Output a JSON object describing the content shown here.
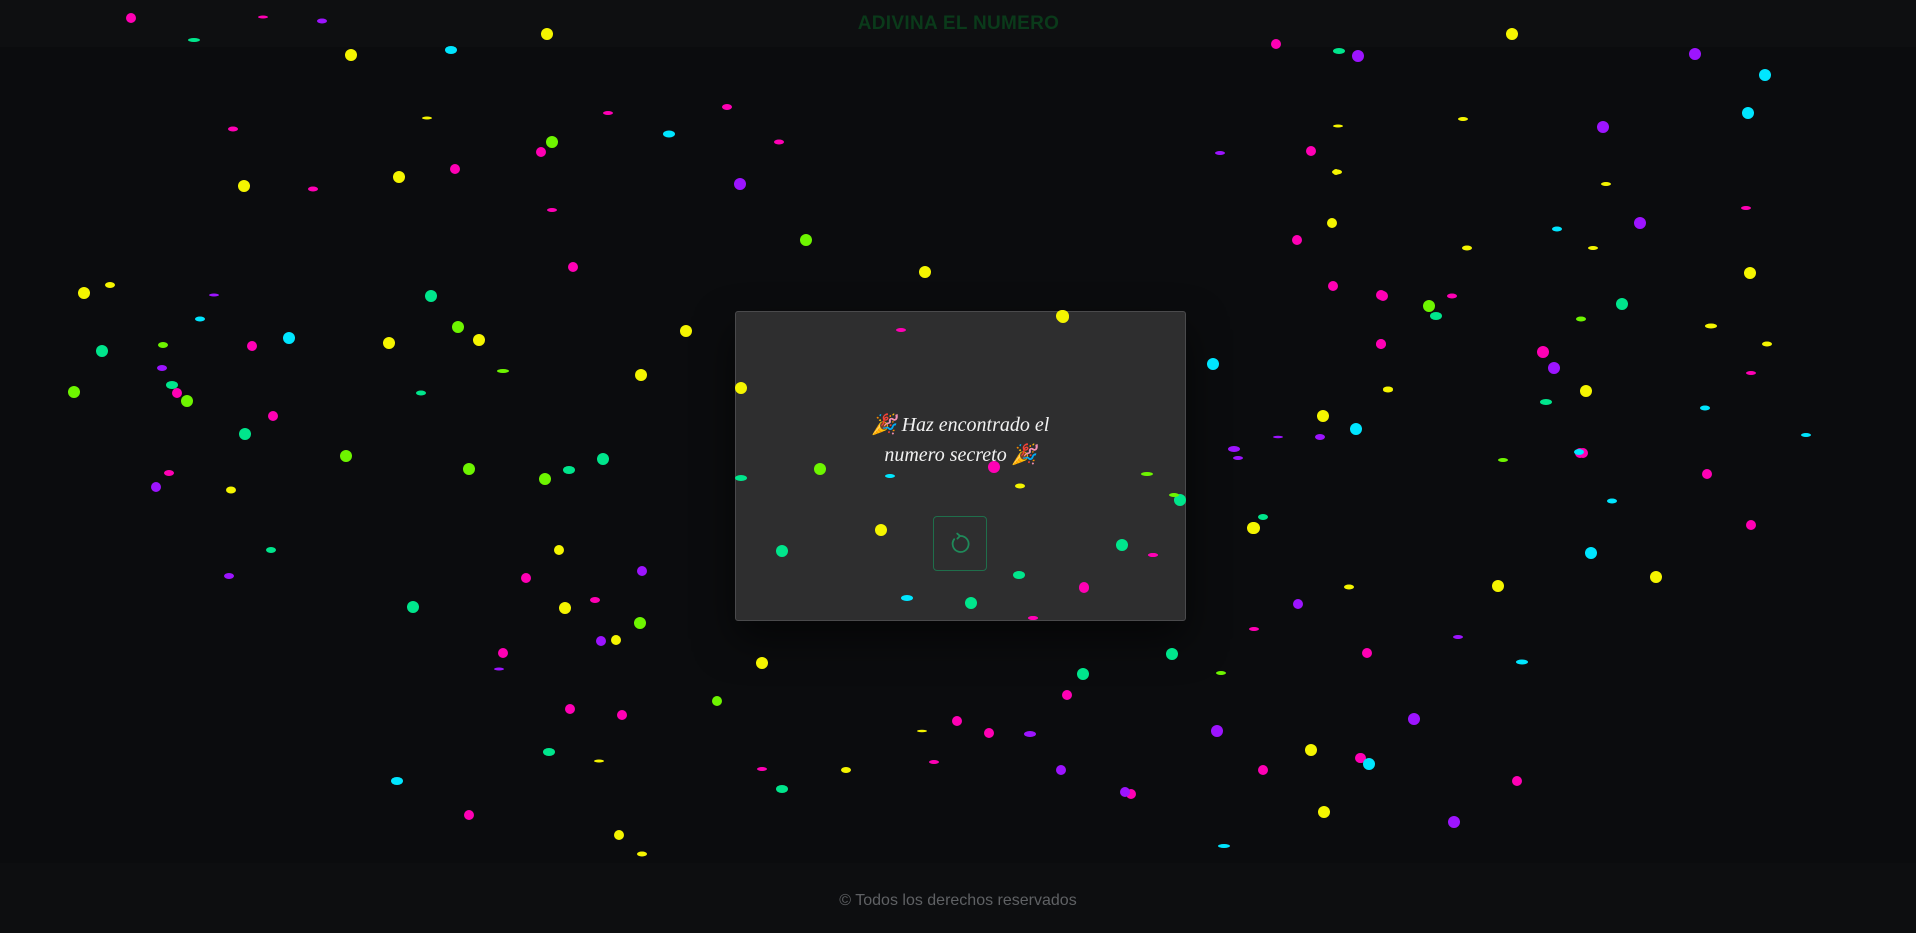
{
  "header": {
    "title": "ADIVINA EL NUMERO"
  },
  "modal": {
    "message_line1": "🎉 Haz encontrado el",
    "message_line2": "numero secreto 🎉",
    "restart_icon": "refresh-icon"
  },
  "footer": {
    "text": "© Todos los derechos reservados"
  },
  "colors": {
    "background": "#0b0c0e",
    "modal": "#2e2e2f",
    "accent": "#1f6e4b",
    "confetti": [
      "#ff00b4",
      "#f5f500",
      "#9d14ff",
      "#00e6ff",
      "#00e68c",
      "#6ef500"
    ]
  }
}
